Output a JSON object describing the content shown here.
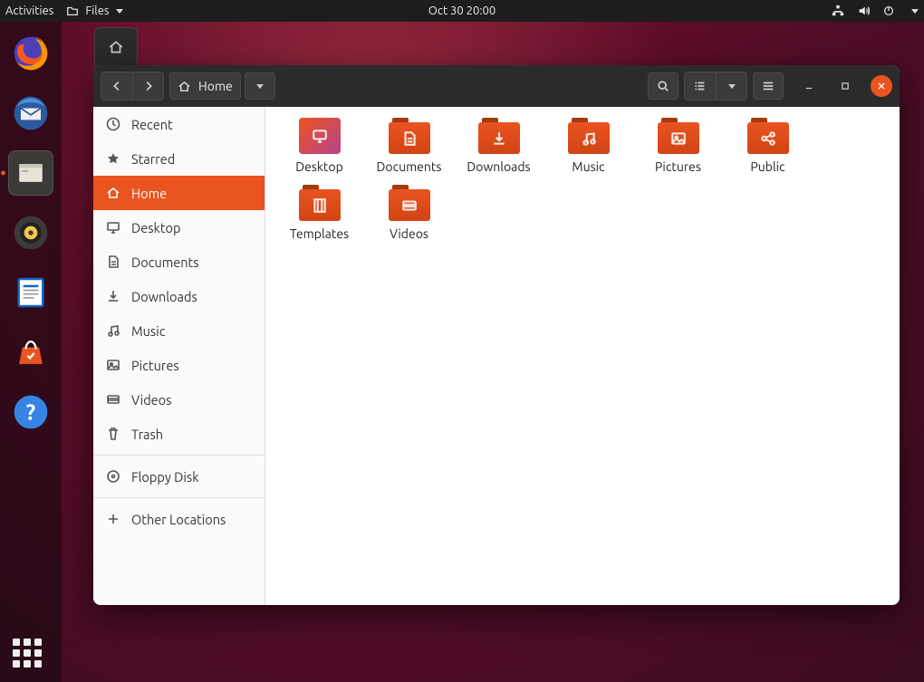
{
  "topbar": {
    "activities": "Activities",
    "app_menu": "Files",
    "clock": "Oct 30  20:00"
  },
  "window": {
    "location_label": "Home"
  },
  "sidebar": {
    "items": [
      {
        "label": "Recent",
        "icon": "clock"
      },
      {
        "label": "Starred",
        "icon": "star"
      },
      {
        "label": "Home",
        "icon": "home",
        "active": true
      },
      {
        "label": "Desktop",
        "icon": "desktop"
      },
      {
        "label": "Documents",
        "icon": "doc"
      },
      {
        "label": "Downloads",
        "icon": "download"
      },
      {
        "label": "Music",
        "icon": "music"
      },
      {
        "label": "Pictures",
        "icon": "picture"
      },
      {
        "label": "Videos",
        "icon": "video"
      },
      {
        "label": "Trash",
        "icon": "trash"
      }
    ],
    "devices": [
      {
        "label": "Floppy Disk",
        "icon": "disk"
      }
    ],
    "other": [
      {
        "label": "Other Locations",
        "icon": "plus"
      }
    ]
  },
  "folders": [
    {
      "label": "Desktop",
      "icon": "desktop",
      "variant": "desktop"
    },
    {
      "label": "Documents",
      "icon": "doc"
    },
    {
      "label": "Downloads",
      "icon": "download"
    },
    {
      "label": "Music",
      "icon": "music"
    },
    {
      "label": "Pictures",
      "icon": "picture"
    },
    {
      "label": "Public",
      "icon": "share"
    },
    {
      "label": "Templates",
      "icon": "template"
    },
    {
      "label": "Videos",
      "icon": "video"
    }
  ]
}
